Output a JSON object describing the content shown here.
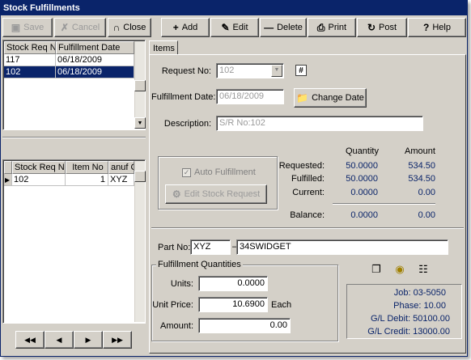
{
  "window": {
    "title": "Stock Fulfillments"
  },
  "toolbar_left": {
    "save": "Save",
    "cancel": "Cancel",
    "close": "Close"
  },
  "toolbar_right": {
    "add": "Add",
    "edit": "Edit",
    "delete": "Delete",
    "print": "Print",
    "post": "Post",
    "help": "Help"
  },
  "top_grid": {
    "headers": [
      "Stock Req No",
      "Fulfillment Date"
    ],
    "rows": [
      [
        "117",
        "06/18/2009"
      ],
      [
        "102",
        "06/18/2009"
      ]
    ]
  },
  "bottom_grid": {
    "headers": [
      "Stock Req No",
      "Item No",
      "anuf Co"
    ],
    "rows": [
      [
        "102",
        "1",
        "XYZ"
      ]
    ]
  },
  "nav": [
    "first",
    "prev",
    "next",
    "last"
  ],
  "tabs": [
    "Items"
  ],
  "form": {
    "request_no_label": "Request No:",
    "request_no": "102",
    "fulfillment_date_label": "Fulfillment Date:",
    "fulfillment_date": "06/18/2009",
    "change_date": "Change Date",
    "description_label": "Description:",
    "description": "S/R No:102",
    "auto_fulfillment": "Auto Fulfillment",
    "edit_stock_request": "Edit Stock Request",
    "quantity_header": "Quantity",
    "amount_header": "Amount",
    "requested_label": "Requested:",
    "requested_qty": "50.0000",
    "requested_amt": "534.50",
    "fulfilled_label": "Fulfilled:",
    "fulfilled_qty": "50.0000",
    "fulfilled_amt": "534.50",
    "current_label": "Current:",
    "current_qty": "0.0000",
    "current_amt": "0.00",
    "balance_label": "Balance:",
    "balance_qty": "0.0000",
    "balance_amt": "0.00",
    "part_no_label": "Part No:",
    "part_manuf": "XYZ",
    "part_dash": "–",
    "part_no": "34SWIDGET",
    "fq_title": "Fulfillment Quantities",
    "units_label": "Units:",
    "units": "0.0000",
    "unit_price_label": "Unit Price:",
    "unit_price": "10.6900",
    "each": "Each",
    "amount_label": "Amount:",
    "amount": "0.00",
    "job": "Job: 03-5050",
    "phase": "Phase: 10.00",
    "gl_debit": "G/L Debit: 50100.00",
    "gl_credit": "G/L Credit: 13000.00"
  }
}
